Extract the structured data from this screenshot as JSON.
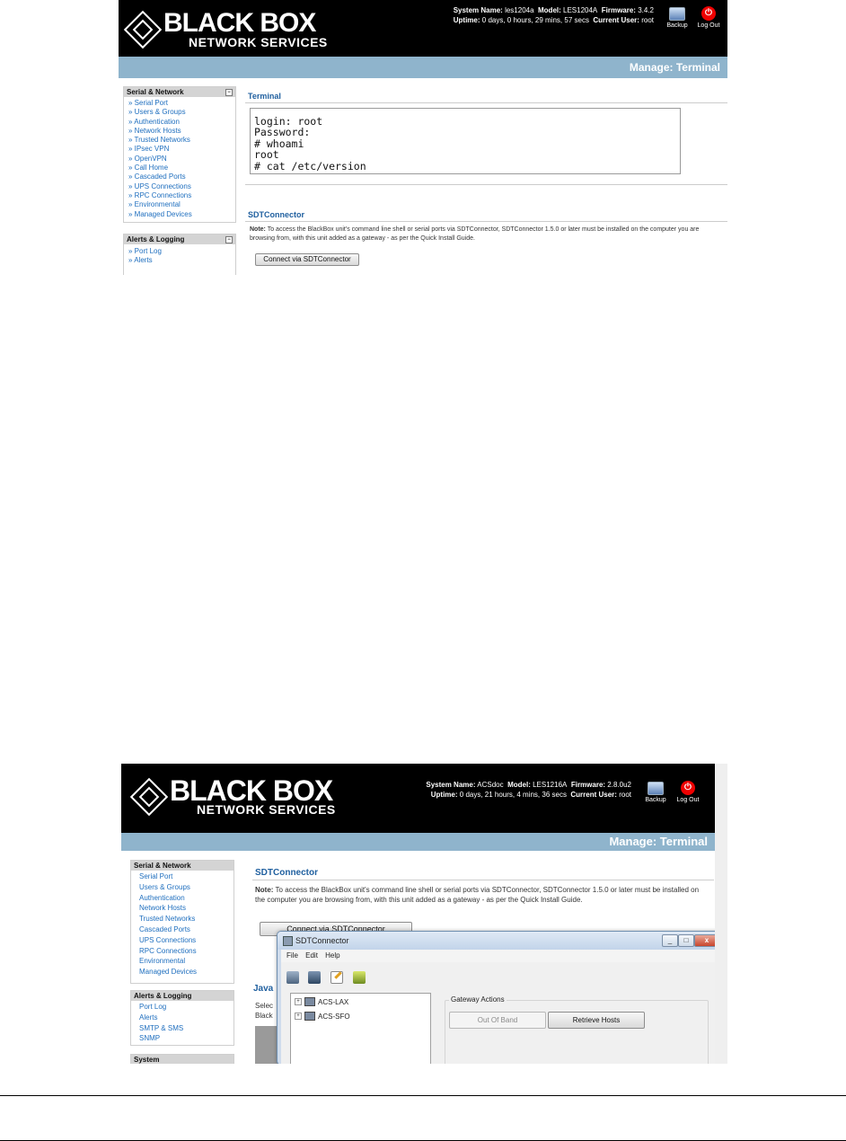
{
  "shot1": {
    "logo": {
      "main": "BLACK BOX",
      "sub": "NETWORK SERVICES"
    },
    "sysinfo": {
      "line1": [
        {
          "label": "System Name:",
          "value": "les1204a"
        },
        {
          "label": "Model:",
          "value": "LES1204A"
        },
        {
          "label": "Firmware:",
          "value": "3.4.2"
        }
      ],
      "line2": [
        {
          "label": "Uptime:",
          "value": "0 days, 0 hours, 29 mins, 57 secs"
        },
        {
          "label": "Current User:",
          "value": "root"
        }
      ]
    },
    "top_buttons": {
      "backup": "Backup",
      "logout": "Log Out"
    },
    "manage_title": "Manage: Terminal",
    "sidebar": [
      {
        "heading": "Serial & Network",
        "items": [
          "» Serial Port",
          "» Users & Groups",
          "» Authentication",
          "» Network Hosts",
          "» Trusted Networks",
          "» IPsec VPN",
          "» OpenVPN",
          "» Call Home",
          "» Cascaded Ports",
          "» UPS Connections",
          "» RPC Connections",
          "» Environmental",
          "» Managed Devices"
        ]
      },
      {
        "heading": "Alerts & Logging",
        "items": [
          "» Port Log",
          "» Alerts"
        ]
      }
    ],
    "terminal": {
      "title": "Terminal",
      "lines": [
        "login: root",
        "Password:",
        "# whoami",
        "root",
        "# cat /etc/version"
      ]
    },
    "sdt": {
      "title": "SDTConnector",
      "note_label": "Note:",
      "note_text": "To access the BlackBox unit's command line shell or serial ports via SDTConnector, SDTConnector 1.5.0 or later must be installed on the computer you are browsing from, with this unit added as a gateway - as per the Quick Install Guide.",
      "button": "Connect via SDTConnector"
    }
  },
  "shot2": {
    "logo": {
      "main": "BLACK BOX",
      "sub": "NETWORK SERVICES"
    },
    "sysinfo": {
      "line1": [
        {
          "label": "System Name:",
          "value": "ACSdoc"
        },
        {
          "label": "Model:",
          "value": "LES1216A"
        },
        {
          "label": "Firmware:",
          "value": "2.8.0u2"
        }
      ],
      "line2": [
        {
          "label": "Uptime:",
          "value": "0 days, 21 hours, 4 mins, 36 secs"
        },
        {
          "label": "Current User:",
          "value": "root"
        }
      ]
    },
    "top_buttons": {
      "backup": "Backup",
      "logout": "Log Out"
    },
    "manage_title": "Manage: Terminal",
    "sidebar": [
      {
        "heading": "Serial & Network",
        "items": [
          "Serial Port",
          "Users & Groups",
          "Authentication",
          "Network Hosts",
          "Trusted Networks",
          "Cascaded Ports",
          "UPS Connections",
          "RPC Connections",
          "Environmental",
          "Managed Devices"
        ]
      },
      {
        "heading": "Alerts & Logging",
        "items": [
          "Port Log",
          "Alerts",
          "SMTP & SMS",
          "SNMP"
        ]
      },
      {
        "heading": "System",
        "items": []
      }
    ],
    "sdt": {
      "title": "SDTConnector",
      "note_label": "Note:",
      "note_text": "To access the BlackBox unit's command line shell or serial ports via SDTConnector, SDTConnector 1.5.0 or later must be installed on the computer you are browsing from, with this unit added as a gateway - as per the Quick Install Guide.",
      "button": "Connect via SDTConnector"
    },
    "java": {
      "title_partial": "Java",
      "line1": "Selec",
      "line2": "Black"
    },
    "app_window": {
      "title": "SDTConnector",
      "controls": [
        "_",
        "□",
        "x"
      ],
      "menu": [
        "File",
        "Edit",
        "Help"
      ],
      "toolbar_icons": [
        "network-gateway-icon",
        "computer-icon",
        "edit-icon",
        "disk-icon"
      ],
      "tree": [
        {
          "expander": "+",
          "label": "ACS-LAX"
        },
        {
          "expander": "+",
          "label": "ACS-SFO"
        }
      ],
      "gateway_actions": {
        "label": "Gateway Actions",
        "out_of_band": "Out Of Band",
        "retrieve_hosts": "Retrieve Hosts"
      }
    }
  }
}
